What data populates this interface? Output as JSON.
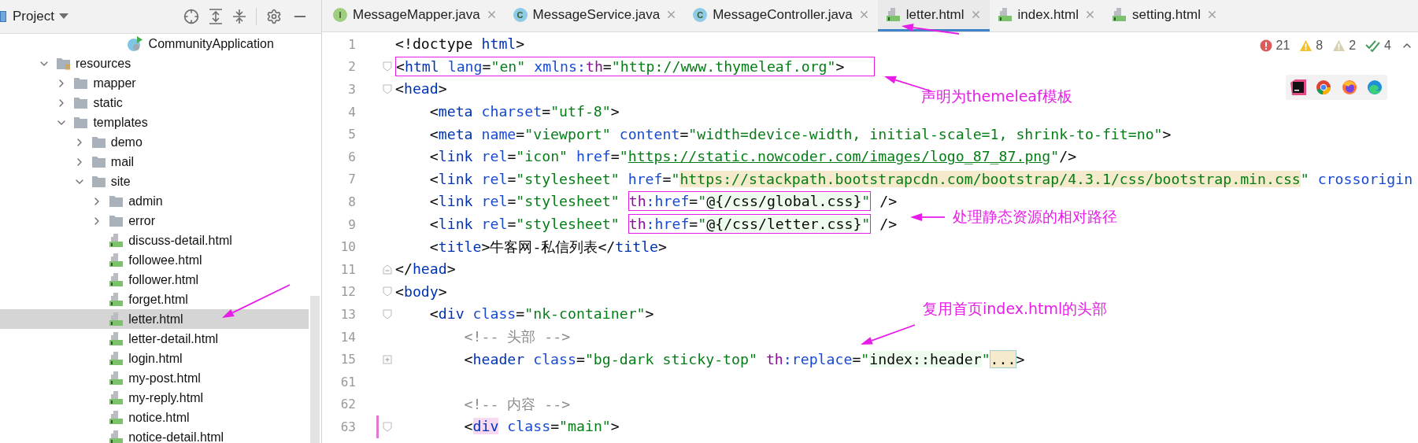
{
  "project_panel": {
    "title": "Project"
  },
  "project_tree": {
    "partial_item": {
      "label": "CommunityApplication",
      "kind": "app",
      "selected": false
    },
    "items": [
      {
        "label": "resources",
        "kind": "resources",
        "expanded": true,
        "selected": false,
        "children": [
          {
            "label": "mapper",
            "kind": "folder",
            "expanded": false,
            "selected": false
          },
          {
            "label": "static",
            "kind": "folder",
            "expanded": false,
            "selected": false
          },
          {
            "label": "templates",
            "kind": "folder",
            "expanded": true,
            "selected": false,
            "children": [
              {
                "label": "demo",
                "kind": "folder",
                "expanded": false,
                "selected": false
              },
              {
                "label": "mail",
                "kind": "folder",
                "expanded": false,
                "selected": false
              },
              {
                "label": "site",
                "kind": "folder",
                "expanded": true,
                "selected": false,
                "children": [
                  {
                    "label": "admin",
                    "kind": "folder",
                    "expanded": false,
                    "selected": false
                  },
                  {
                    "label": "error",
                    "kind": "folder",
                    "expanded": false,
                    "selected": false
                  },
                  {
                    "label": "discuss-detail.html",
                    "kind": "html",
                    "selected": false
                  },
                  {
                    "label": "followee.html",
                    "kind": "html",
                    "selected": false
                  },
                  {
                    "label": "follower.html",
                    "kind": "html",
                    "selected": false
                  },
                  {
                    "label": "forget.html",
                    "kind": "html",
                    "selected": false
                  },
                  {
                    "label": "letter.html",
                    "kind": "html",
                    "selected": true
                  },
                  {
                    "label": "letter-detail.html",
                    "kind": "html",
                    "selected": false
                  },
                  {
                    "label": "login.html",
                    "kind": "html",
                    "selected": false
                  },
                  {
                    "label": "my-post.html",
                    "kind": "html",
                    "selected": false
                  },
                  {
                    "label": "my-reply.html",
                    "kind": "html",
                    "selected": false
                  },
                  {
                    "label": "notice.html",
                    "kind": "html",
                    "selected": false
                  },
                  {
                    "label": "notice-detail.html",
                    "kind": "html",
                    "selected": false
                  }
                ]
              }
            ]
          }
        ]
      }
    ]
  },
  "tabs": [
    {
      "label": "MessageMapper.java",
      "kind": "interface",
      "icon_letter": "I",
      "selected": false
    },
    {
      "label": "MessageService.java",
      "kind": "class",
      "icon_letter": "C",
      "selected": false
    },
    {
      "label": "MessageController.java",
      "kind": "class",
      "icon_letter": "C",
      "selected": false
    },
    {
      "label": "letter.html",
      "kind": "html",
      "selected": true
    },
    {
      "label": "index.html",
      "kind": "html",
      "selected": false
    },
    {
      "label": "setting.html",
      "kind": "html",
      "selected": false
    }
  ],
  "inspections": [
    {
      "kind": "error",
      "count": "21"
    },
    {
      "kind": "warning",
      "count": "8"
    },
    {
      "kind": "weak",
      "count": "2"
    },
    {
      "kind": "typo",
      "count": "4"
    }
  ],
  "code_lines": [
    {
      "number": "1",
      "changed": false,
      "segments": [
        {
          "kind": "p",
          "t": "<!doctype"
        },
        {
          "kind": "tag",
          "t": " html"
        },
        {
          "kind": "p",
          "t": ">"
        }
      ]
    },
    {
      "number": "2",
      "changed": false,
      "fold": {
        "kind": "open"
      },
      "segments": [
        {
          "kind": "box",
          "parts": [
            {
              "kind": "p",
              "t": "<"
            },
            {
              "kind": "tag",
              "t": "html"
            },
            {
              "kind": "attr",
              "t": " lang"
            },
            {
              "kind": "p",
              "t": "="
            },
            {
              "kind": "val",
              "t": "\"en\""
            },
            {
              "kind": "attr",
              "t": " xmlns:"
            },
            {
              "kind": "ns",
              "t": "th"
            },
            {
              "kind": "p",
              "t": "="
            },
            {
              "kind": "val",
              "t": "\"http://www.thymeleaf.org\""
            },
            {
              "kind": "p",
              "t": ">"
            }
          ]
        }
      ]
    },
    {
      "number": "3",
      "changed": false,
      "fold": {
        "kind": "open"
      },
      "segments": [
        {
          "kind": "p",
          "t": "<"
        },
        {
          "kind": "tag",
          "t": "head"
        },
        {
          "kind": "p",
          "t": ">"
        }
      ]
    },
    {
      "number": "4",
      "changed": false,
      "segments": [
        {
          "kind": "p",
          "t": "    <"
        },
        {
          "kind": "tag",
          "t": "meta"
        },
        {
          "kind": "attr",
          "t": " charset"
        },
        {
          "kind": "p",
          "t": "="
        },
        {
          "kind": "val",
          "t": "\"utf-8\""
        },
        {
          "kind": "p",
          "t": ">"
        }
      ]
    },
    {
      "number": "5",
      "changed": false,
      "segments": [
        {
          "kind": "p",
          "t": "    <"
        },
        {
          "kind": "tag",
          "t": "meta"
        },
        {
          "kind": "attr",
          "t": " name"
        },
        {
          "kind": "p",
          "t": "="
        },
        {
          "kind": "val",
          "t": "\"viewport\""
        },
        {
          "kind": "attr",
          "t": " content"
        },
        {
          "kind": "p",
          "t": "="
        },
        {
          "kind": "val",
          "t": "\"width=device-width, initial-scale=1, shrink-to-fit=no\""
        },
        {
          "kind": "p",
          "t": ">"
        }
      ]
    },
    {
      "number": "6",
      "changed": false,
      "segments": [
        {
          "kind": "p",
          "t": "    <"
        },
        {
          "kind": "tag",
          "t": "link"
        },
        {
          "kind": "attr",
          "t": " rel"
        },
        {
          "kind": "p",
          "t": "="
        },
        {
          "kind": "val",
          "t": "\"icon\""
        },
        {
          "kind": "attr",
          "t": " href"
        },
        {
          "kind": "p",
          "t": "="
        },
        {
          "kind": "val",
          "t": "\""
        },
        {
          "kind": "url",
          "t": "https://static.nowcoder.com/images/logo_87_87.png"
        },
        {
          "kind": "val",
          "t": "\""
        },
        {
          "kind": "p",
          "t": "/>"
        }
      ]
    },
    {
      "number": "7",
      "changed": false,
      "segments": [
        {
          "kind": "p",
          "t": "    <"
        },
        {
          "kind": "tag",
          "t": "link"
        },
        {
          "kind": "attr",
          "t": " rel"
        },
        {
          "kind": "p",
          "t": "="
        },
        {
          "kind": "val",
          "t": "\"stylesheet\""
        },
        {
          "kind": "attr",
          "t": " href"
        },
        {
          "kind": "p",
          "t": "="
        },
        {
          "kind": "val",
          "t": "\""
        },
        {
          "kind": "cdn",
          "t": "https://stackpath.bootstrapcdn.com/bootstrap/4.3.1/css/bootstrap.min.css"
        },
        {
          "kind": "val",
          "t": "\""
        },
        {
          "kind": "attr",
          "t": " crossorigin"
        }
      ]
    },
    {
      "number": "8",
      "changed": false,
      "segments": [
        {
          "kind": "p",
          "t": "    <"
        },
        {
          "kind": "tag",
          "t": "link"
        },
        {
          "kind": "attr",
          "t": " rel"
        },
        {
          "kind": "p",
          "t": "="
        },
        {
          "kind": "val",
          "t": "\"stylesheet\" "
        },
        {
          "kind": "box",
          "parts": [
            {
              "kind": "ns",
              "t": "th"
            },
            {
              "kind": "attr",
              "t": ":href"
            },
            {
              "kind": "p",
              "t": "="
            },
            {
              "kind": "val",
              "t": "\""
            },
            {
              "kind": "expr",
              "t": "@{/css/global.css}"
            },
            {
              "kind": "val",
              "t": "\""
            }
          ]
        },
        {
          "kind": "p",
          "t": " />"
        }
      ]
    },
    {
      "number": "9",
      "changed": false,
      "segments": [
        {
          "kind": "p",
          "t": "    <"
        },
        {
          "kind": "tag",
          "t": "link"
        },
        {
          "kind": "attr",
          "t": " rel"
        },
        {
          "kind": "p",
          "t": "="
        },
        {
          "kind": "val",
          "t": "\"stylesheet\" "
        },
        {
          "kind": "box",
          "parts": [
            {
              "kind": "ns",
              "t": "th"
            },
            {
              "kind": "attr",
              "t": ":href"
            },
            {
              "kind": "p",
              "t": "="
            },
            {
              "kind": "val",
              "t": "\""
            },
            {
              "kind": "expr",
              "t": "@{/css/letter.css}"
            },
            {
              "kind": "val",
              "t": "\""
            }
          ]
        },
        {
          "kind": "p",
          "t": " />"
        }
      ]
    },
    {
      "number": "10",
      "changed": false,
      "segments": [
        {
          "kind": "p",
          "t": "    <"
        },
        {
          "kind": "tag",
          "t": "title"
        },
        {
          "kind": "p",
          "t": ">牛客网-私信列表</"
        },
        {
          "kind": "tag",
          "t": "title"
        },
        {
          "kind": "p",
          "t": ">"
        }
      ]
    },
    {
      "number": "11",
      "changed": false,
      "fold": {
        "kind": "close"
      },
      "segments": [
        {
          "kind": "p",
          "t": "</"
        },
        {
          "kind": "tag",
          "t": "head"
        },
        {
          "kind": "p",
          "t": ">"
        }
      ]
    },
    {
      "number": "12",
      "changed": false,
      "fold": {
        "kind": "open"
      },
      "segments": [
        {
          "kind": "p",
          "t": "<"
        },
        {
          "kind": "tag",
          "t": "body"
        },
        {
          "kind": "p",
          "t": ">"
        }
      ]
    },
    {
      "number": "13",
      "changed": false,
      "fold": {
        "kind": "open"
      },
      "segments": [
        {
          "kind": "p",
          "t": "    <"
        },
        {
          "kind": "tag",
          "t": "div"
        },
        {
          "kind": "attr",
          "t": " class"
        },
        {
          "kind": "p",
          "t": "="
        },
        {
          "kind": "val",
          "t": "\"nk-container\""
        },
        {
          "kind": "p",
          "t": ">"
        }
      ]
    },
    {
      "number": "14",
      "changed": false,
      "segments": [
        {
          "kind": "comment",
          "t": "        <!-- 头部 -->"
        }
      ]
    },
    {
      "number": "15",
      "changed": false,
      "fold": {
        "kind": "collapsed"
      },
      "segments": [
        {
          "kind": "p",
          "t": "        <"
        },
        {
          "kind": "tag",
          "t": "header"
        },
        {
          "kind": "attr",
          "t": " class"
        },
        {
          "kind": "p",
          "t": "="
        },
        {
          "kind": "val",
          "t": "\"bg-dark sticky-top\" "
        },
        {
          "kind": "ns",
          "t": "th"
        },
        {
          "kind": "attr",
          "t": ":replace"
        },
        {
          "kind": "p",
          "t": "="
        },
        {
          "kind": "val",
          "t": "\""
        },
        {
          "kind": "expr",
          "t": "index::header"
        },
        {
          "kind": "val",
          "t": "\""
        },
        {
          "kind": "fold",
          "t": "..."
        },
        {
          "kind": "p",
          "t": ">"
        }
      ]
    },
    {
      "number": "61",
      "changed": false
    },
    {
      "number": "62",
      "changed": false,
      "segments": [
        {
          "kind": "comment",
          "t": "        <!-- 内容 -->"
        }
      ]
    },
    {
      "number": "63",
      "changed": true,
      "fold": {
        "kind": "open"
      },
      "segments": [
        {
          "kind": "p",
          "t": "        <"
        },
        {
          "kind": "match",
          "t": "div"
        },
        {
          "kind": "attr",
          "t": " class"
        },
        {
          "kind": "p",
          "t": "="
        },
        {
          "kind": "val",
          "t": "\"main\""
        },
        {
          "kind": "p",
          "t": ">"
        }
      ]
    }
  ],
  "annotations": [
    {
      "text": "声明为themeleaf模板"
    },
    {
      "text": "处理静态资源的相对路径"
    },
    {
      "text": "复用首页index.html的头部"
    }
  ]
}
